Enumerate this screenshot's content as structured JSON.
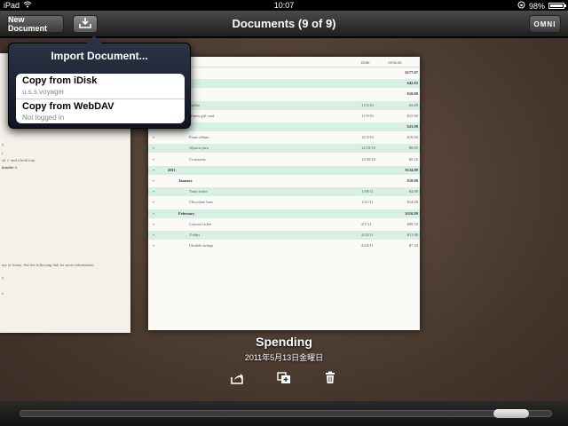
{
  "status_bar": {
    "device": "iPad",
    "time": "10:07",
    "battery_percent": "98%",
    "battery_level": 0.98
  },
  "toolbar": {
    "new_document_label": "New Document",
    "title": "Documents (9 of 9)",
    "omni_label": "OMNI"
  },
  "popover": {
    "title": "Import Document...",
    "items": [
      {
        "label": "Copy from iDisk",
        "sublabel": "u.s.s.voyager"
      },
      {
        "label": "Copy from WebDAV",
        "sublabel": "Not logged in"
      }
    ]
  },
  "left_document": {
    "lines": [
      "y.",
      "t",
      "ck ✓ and a bold font.",
      "d style.",
      "you see it.",
      "ary of forms. See the following link for more information",
      "y.",
      "e"
    ]
  },
  "main_document": {
    "title": "Spending",
    "date": "2011年5月13日金曜日",
    "columns": {
      "date": "Date",
      "amount": "Amount"
    },
    "rows": [
      {
        "label": "",
        "date": "",
        "amount": "$177.07",
        "bold": true,
        "hl": false
      },
      {
        "label": "",
        "date": "",
        "amount": "$42.83",
        "bold": true,
        "hl": true
      },
      {
        "label": "ember",
        "date": "",
        "amount": "$18.89",
        "bold": true,
        "hl": false
      },
      {
        "label": "Coffee",
        "date": "11/5/10",
        "amount": "$3.89",
        "bold": false,
        "hl": true
      },
      {
        "label": "iTunes gift card",
        "date": "11/9/10",
        "amount": "$15.00",
        "bold": false,
        "hl": false
      },
      {
        "label": "ember",
        "date": "",
        "amount": "$23.99",
        "bold": true,
        "hl": true
      },
      {
        "label": "Piano album",
        "date": "12/3/10",
        "amount": "$10.04",
        "bold": false,
        "hl": false
      },
      {
        "label": "Alpaca yarn",
        "date": "12/10/10",
        "amount": "$8.85",
        "bold": false,
        "hl": true
      },
      {
        "label": "Croissants",
        "date": "12/30/10",
        "amount": "$5.10",
        "bold": false,
        "hl": false
      },
      {
        "label": "2011",
        "date": "",
        "amount": "$134.99",
        "bold": true,
        "hl": true
      },
      {
        "label": "January",
        "date": "",
        "amount": "$18.00",
        "bold": true,
        "hl": false
      },
      {
        "label": "Train ticket",
        "date": "1/18/11",
        "amount": "$4.00",
        "bold": false,
        "hl": true
      },
      {
        "label": "Chocolate bars",
        "date": "1/21/11",
        "amount": "$14.00",
        "bold": false,
        "hl": false
      },
      {
        "label": "February",
        "date": "",
        "amount": "$116.99",
        "bold": true,
        "hl": true
      },
      {
        "label": "Concert ticket",
        "date": "2/1/11",
        "amount": "$98.55",
        "bold": false,
        "hl": false
      },
      {
        "label": "T-shirt",
        "date": "2/23/11",
        "amount": "$11.00",
        "bold": false,
        "hl": true
      },
      {
        "label": "Ukulele strings",
        "date": "2/24/11",
        "amount": "$7.44",
        "bold": false,
        "hl": false
      }
    ]
  },
  "icons": {
    "import": "import-tray-icon",
    "share": "share-icon",
    "duplicate": "duplicate-icon",
    "trash": "trash-icon",
    "wifi": "wifi-icon",
    "lock": "orientation-lock-icon"
  },
  "scrubber": {
    "position": 0.96
  }
}
